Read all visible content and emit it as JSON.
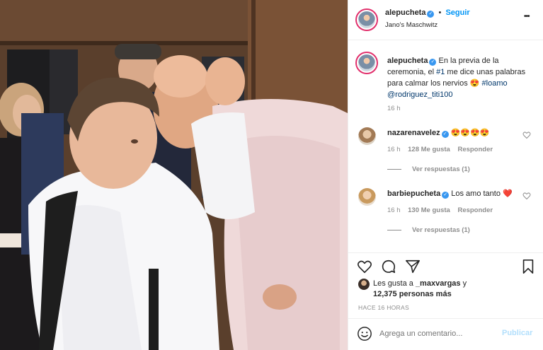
{
  "post": {
    "username": "alepucheta",
    "follow_label": "Seguir",
    "location": "Jano's Maschwitz",
    "more_label": "•••"
  },
  "caption": {
    "username": "alepucheta",
    "text_before_tag": "En la previa de la ceremonia, el ",
    "tag_1": "#1",
    "text_after_tag": " me dice unas palabras para calmar los nervios 😍 ",
    "tag_2": "#loamo",
    "mention": "@rodriguez_titi100",
    "time": "16 h"
  },
  "comments": [
    {
      "username": "nazarenavelez",
      "text": "😍😍😍😍",
      "time": "16 h",
      "likes": "128 Me gusta",
      "reply_label": "Responder",
      "view_replies": "Ver respuestas (1)"
    },
    {
      "username": "barbiepucheta",
      "text": "Los amo tanto ❤️",
      "time": "16 h",
      "likes": "130 Me gusta",
      "reply_label": "Responder",
      "view_replies": "Ver respuestas (1)"
    }
  ],
  "likes": {
    "prefix": "Les gusta a ",
    "user": "_maxvargas",
    "suffix": " y",
    "others": "12,375 personas más"
  },
  "timestamp": "HACE 16 HORAS",
  "comment_input": {
    "placeholder": "Agrega un comentario...",
    "publish_label": "Publicar"
  },
  "colors": {
    "accent": "#0095f6",
    "verified": "#3897f0",
    "story_ring": "#e1306c"
  },
  "icons": {
    "like": "heart-icon",
    "comment": "comment-icon",
    "share": "paper-plane-icon",
    "save": "bookmark-icon",
    "emoji": "smiley-icon"
  }
}
